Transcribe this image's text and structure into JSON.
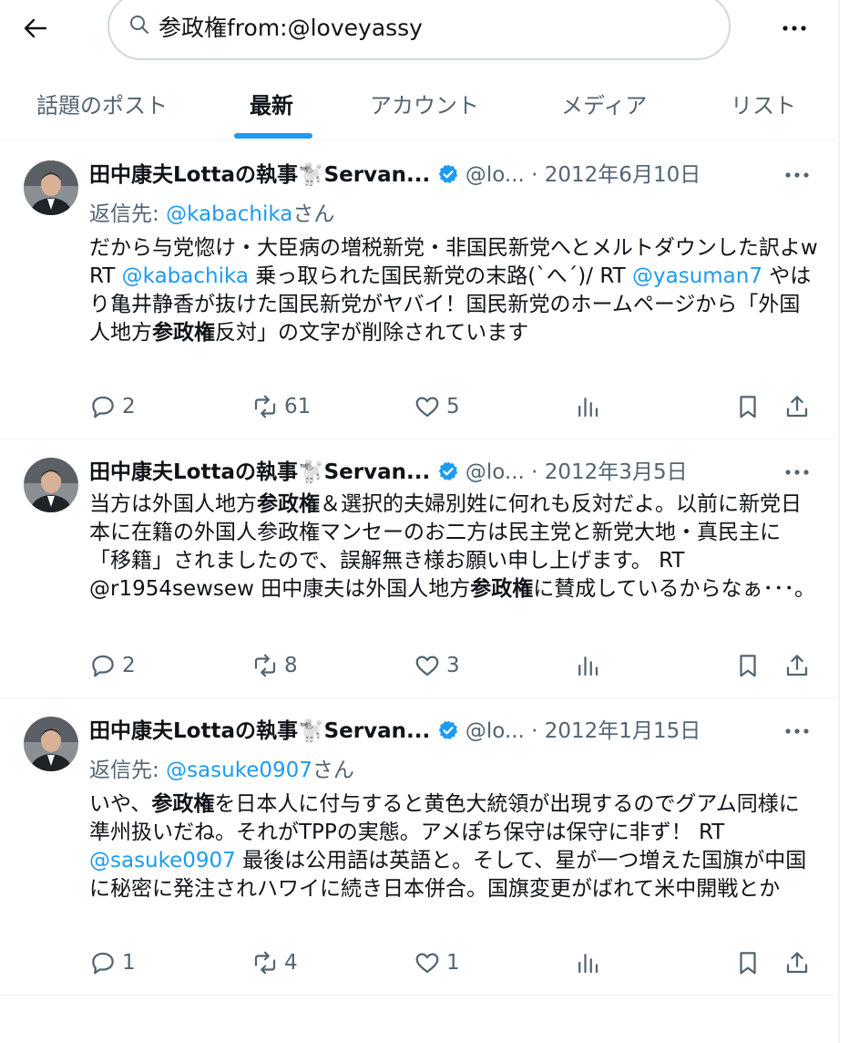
{
  "search": {
    "query": "参政権from:@loveyassy"
  },
  "tabs": [
    "話題のポスト",
    "最新",
    "アカウント",
    "メディア",
    "リスト"
  ],
  "posts": [
    {
      "name": "田中康夫Lottaの執事🐩Servan...",
      "handle": "@lo...",
      "date": "· 2012年6月10日",
      "reply_to": {
        "prefix": "返信先: ",
        "handle": "@kabachika",
        "suffix": "さん"
      },
      "text": {
        "p1": "だから与党惚け・大臣病の増税新党・非国民新党へとメルトダウンした訳よw RT ",
        "m1": "@kabachika",
        "p2": " 乗っ取られた国民新党の末路(`へ´)/ RT ",
        "m2": "@yasuman7",
        "p3": " やはり亀井静香が抜けた国民新党がヤバイ！国民新党のホームページから「外国人地方",
        "kw": "参政権",
        "p4": "反対」の文字が削除されています"
      },
      "stats": {
        "replies": "2",
        "reposts": "61",
        "likes": "5"
      }
    },
    {
      "name": "田中康夫Lottaの執事🐩Servan...",
      "handle": "@lo...",
      "date": "· 2012年3月5日",
      "text": {
        "p1": "当方は外国人地方",
        "kw1": "参政権",
        "p2": "＆選択的夫婦別姓に何れも反対だよ。以前に新党日本に在籍の外国人参政権マンセーのお二方は民主党と新党大地・真民主に「移籍」されましたので、誤解無き様お願い申し上げます。 RT @r1954sewsew 田中康夫は外国人地方",
        "kw2": "参政権",
        "p3": "に賛成しているからなぁ･･･。"
      },
      "stats": {
        "replies": "2",
        "reposts": "8",
        "likes": "3"
      }
    },
    {
      "name": "田中康夫Lottaの執事🐩Servan...",
      "handle": "@lo...",
      "date": "· 2012年1月15日",
      "reply_to": {
        "prefix": "返信先: ",
        "handle": "@sasuke0907",
        "suffix": "さん"
      },
      "text": {
        "p1": "いや、",
        "kw": "参政権",
        "p2": "を日本人に付与すると黄色大統領が出現するのでグアム同様に準州扱いだね。それがTPPの実態。アメぽち保守は保守に非ず！ RT ",
        "m1": "@sasuke0907",
        "p3": " 最後は公用語は英語と。そして、星が一つ増えた国旗が中国に秘密に発注されハワイに続き日本併合。国旗変更がばれて米中開戦とか"
      },
      "stats": {
        "replies": "1",
        "reposts": "4",
        "likes": "1"
      }
    }
  ],
  "colors": {
    "accent": "#1d9bf0",
    "secondary_text": "#536471",
    "verified": "#1d9bf0"
  },
  "icons": [
    "back-arrow-icon",
    "search-icon",
    "more-icon",
    "verified-badge-icon",
    "reply-icon",
    "repost-icon",
    "like-icon",
    "views-icon",
    "bookmark-icon",
    "share-icon"
  ]
}
